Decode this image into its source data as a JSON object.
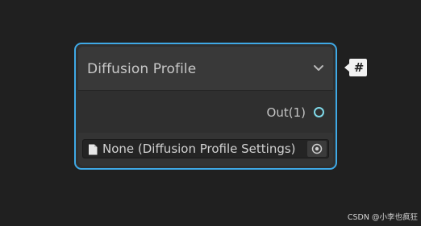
{
  "node": {
    "title": "Diffusion Profile",
    "collapse_icon": "chevron-down-icon",
    "output": {
      "label": "Out(1)",
      "port_icon": "output-port-icon"
    },
    "field": {
      "value": "None (Diffusion Profile Settings)",
      "file_icon": "file-icon",
      "picker_icon": "object-picker-icon"
    },
    "type_badge": "#"
  },
  "watermark": "CSDN @小李也疯狂",
  "colors": {
    "selection_outline": "#3fa9e6",
    "port": "#7fd8e8",
    "background": "#202020",
    "node_body": "#2f2f2f",
    "node_header": "#393939"
  }
}
